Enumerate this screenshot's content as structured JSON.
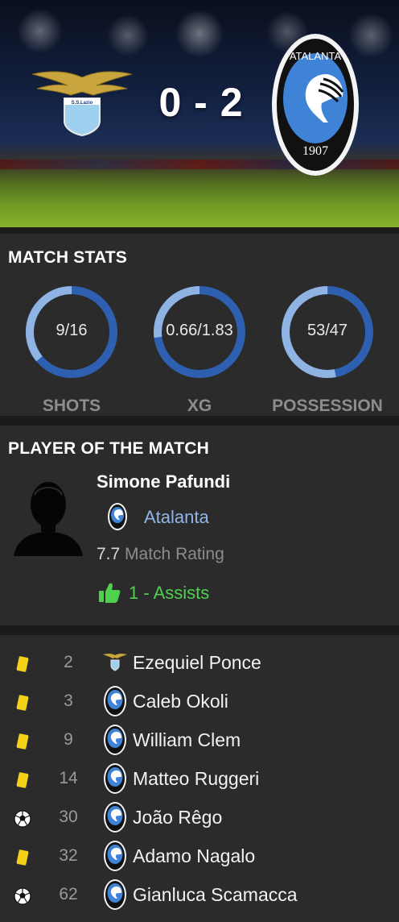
{
  "match": {
    "home_team": "S.S.Lazio",
    "away_team": "Atalanta",
    "score": "0 - 2",
    "away_crest_text": "ATALANTA",
    "away_crest_year": "1907"
  },
  "stats": {
    "title": "MATCH STATS",
    "items": [
      {
        "label": "SHOTS",
        "value": "9/16",
        "home_share": 0.36
      },
      {
        "label": "XG",
        "value": "0.66/1.83",
        "home_share": 0.27
      },
      {
        "label": "POSSESSION",
        "value": "53/47",
        "home_share": 0.53
      }
    ],
    "colors": {
      "home": "#8fb4e4",
      "away": "#2f5fb1"
    }
  },
  "potm": {
    "title": "PLAYER OF THE MATCH",
    "name": "Simone Pafundi",
    "team": "Atalanta",
    "rating": "7.7",
    "rating_label": "Match Rating",
    "award": "1 - Assists",
    "award_icon": "thumbs-up-icon"
  },
  "events": [
    {
      "type": "yellow-card",
      "minute": "2",
      "team": "lazio",
      "player": "Ezequiel Ponce"
    },
    {
      "type": "yellow-card",
      "minute": "3",
      "team": "atalanta",
      "player": "Caleb Okoli"
    },
    {
      "type": "yellow-card",
      "minute": "9",
      "team": "atalanta",
      "player": "William Clem"
    },
    {
      "type": "yellow-card",
      "minute": "14",
      "team": "atalanta",
      "player": "Matteo Ruggeri"
    },
    {
      "type": "goal",
      "minute": "30",
      "team": "atalanta",
      "player": "João Rêgo"
    },
    {
      "type": "yellow-card",
      "minute": "32",
      "team": "atalanta",
      "player": "Adamo Nagalo"
    },
    {
      "type": "goal",
      "minute": "62",
      "team": "atalanta",
      "player": "Gianluca Scamacca"
    }
  ]
}
